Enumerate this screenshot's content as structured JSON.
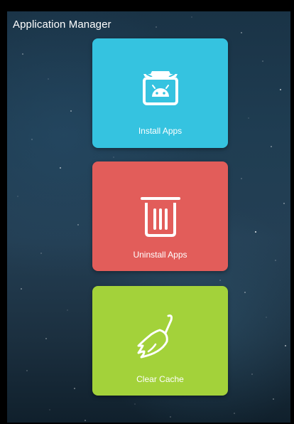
{
  "app": {
    "title": "Application Manager"
  },
  "tiles": [
    {
      "id": "install",
      "label": "Install Apps",
      "color": "#35c3e0",
      "icon": "android-package-icon"
    },
    {
      "id": "uninstall",
      "label": "Uninstall Apps",
      "color": "#e25d5a",
      "icon": "trash-icon"
    },
    {
      "id": "clear",
      "label": "Clear Cache",
      "color": "#a3d23a",
      "icon": "broom-icon"
    }
  ]
}
